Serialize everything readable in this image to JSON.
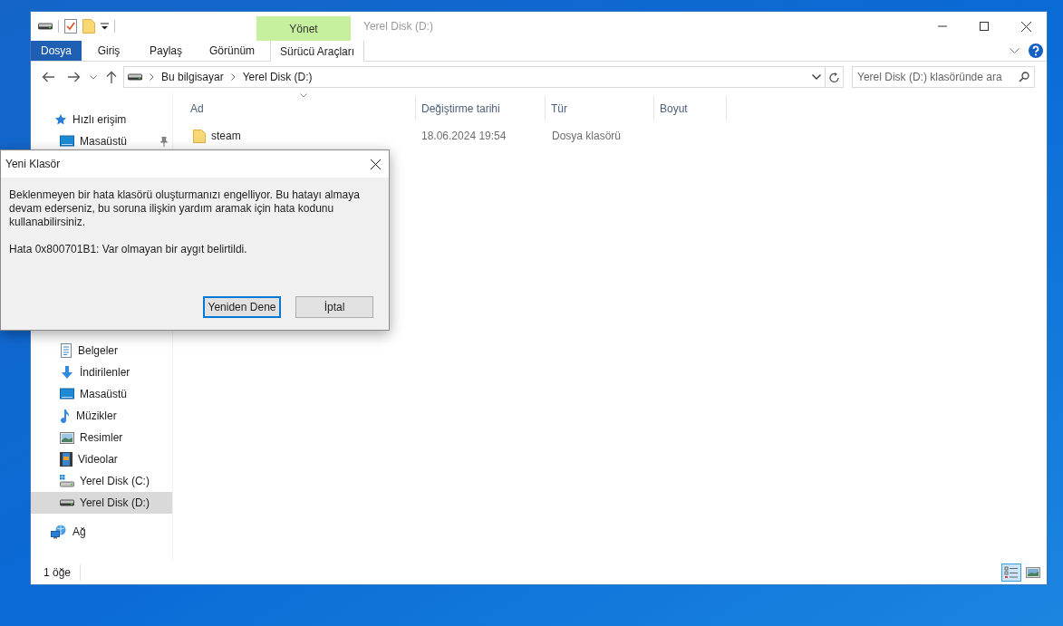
{
  "window": {
    "title": "Yerel Disk (D:)",
    "contextual_group": "Yönet"
  },
  "ribbon_tabs": [
    {
      "label": "Dosya",
      "kind": "file"
    },
    {
      "label": "Giriş",
      "kind": "normal"
    },
    {
      "label": "Paylaş",
      "kind": "normal"
    },
    {
      "label": "Görünüm",
      "kind": "normal"
    },
    {
      "label": "Sürücü Araçları",
      "kind": "contextual"
    }
  ],
  "address": {
    "crumbs": [
      "Bu bilgisayar",
      "Yerel Disk (D:)"
    ]
  },
  "search": {
    "placeholder": "Yerel Disk (D:) klasöründe ara"
  },
  "sidebar": {
    "quick_access": {
      "label": "Hızlı erişim",
      "children": [
        {
          "label": "Masaüstü",
          "kind": "desktop",
          "pinned": true,
          "selected": false
        }
      ]
    },
    "this_pc_items": [
      {
        "label": "Belgeler",
        "kind": "documents",
        "selected": false
      },
      {
        "label": "İndirilenler",
        "kind": "download",
        "selected": false
      },
      {
        "label": "Masaüstü",
        "kind": "desktop",
        "selected": false
      },
      {
        "label": "Müzikler",
        "kind": "music",
        "selected": false
      },
      {
        "label": "Resimler",
        "kind": "pictures",
        "selected": false
      },
      {
        "label": "Videolar",
        "kind": "videos",
        "selected": false
      },
      {
        "label": "Yerel Disk (C:)",
        "kind": "system",
        "selected": false
      },
      {
        "label": "Yerel Disk (D:)",
        "kind": "drive",
        "selected": true
      }
    ],
    "network": {
      "label": "Ağ"
    }
  },
  "table": {
    "columns": [
      "Ad",
      "Değiştirme tarihi",
      "Tür",
      "Boyut"
    ],
    "rows": [
      {
        "name": "steam",
        "modified": "18.06.2024 19:54",
        "type": "Dosya klasörü"
      }
    ]
  },
  "status_bar": {
    "count": "1 öğe"
  },
  "dialog": {
    "title": "Yeni Klasör",
    "message": "Beklenmeyen bir hata klasörü oluşturmanızı engelliyor. Bu hatayı almaya devam ederseniz, bu soruna ilişkin yardım aramak için hata kodunu kullanabilirsiniz.",
    "error": "Hata 0x800701B1: Var olmayan bir aygıt belirtildi.",
    "buttons": [
      {
        "label": "Yeniden Dene",
        "default": true
      },
      {
        "label": "İptal",
        "default": false
      }
    ]
  }
}
